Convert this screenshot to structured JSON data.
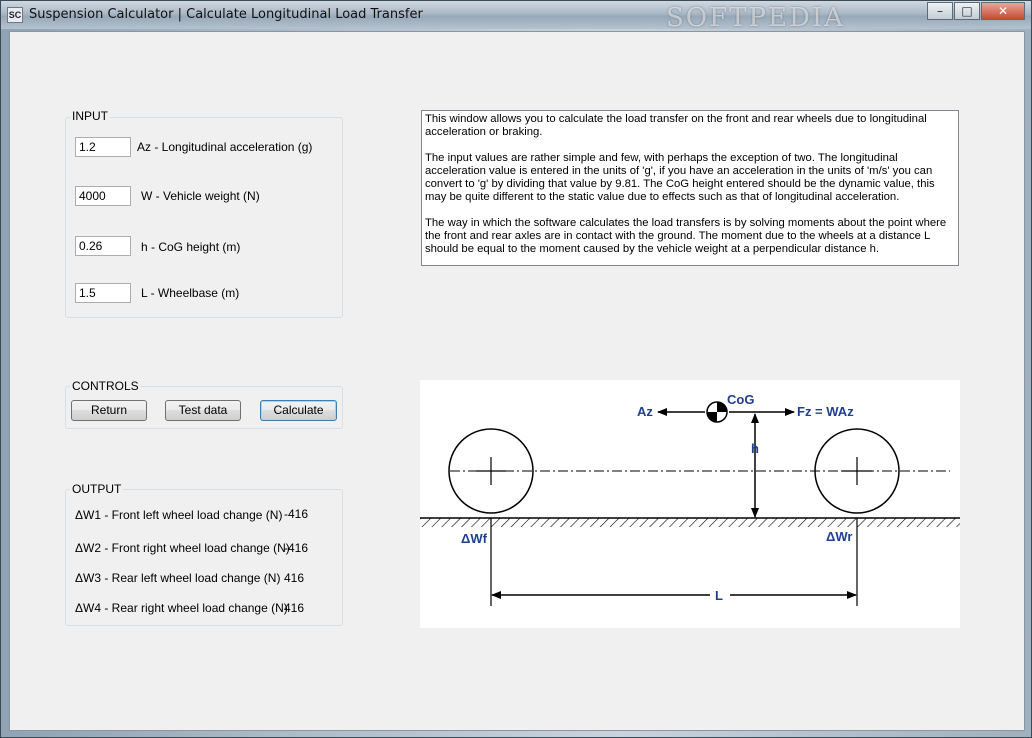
{
  "window": {
    "title": "Suspension Calculator | Calculate Longitudinal Load Transfer",
    "icon_text": "SC",
    "watermark": "SOFTPEDIA",
    "controls": {
      "minimize": "–",
      "maximize": "□",
      "close": "✕"
    }
  },
  "input": {
    "label": "INPUT",
    "fields": [
      {
        "value": "1.2",
        "label": "Az - Longitudinal acceleration (g)"
      },
      {
        "value": "4000",
        "label": "W - Vehicle weight (N)"
      },
      {
        "value": "0.26",
        "label": "h - CoG height (m)"
      },
      {
        "value": "1.5",
        "label": "L - Wheelbase (m)"
      }
    ]
  },
  "controls": {
    "label": "CONTROLS",
    "return_label": "Return",
    "testdata_label": "Test data",
    "calculate_label": "Calculate"
  },
  "output": {
    "label": "OUTPUT",
    "rows": [
      {
        "label": "ΔW1 - Front left wheel load change (N)",
        "value": "-416"
      },
      {
        "label": "ΔW2 - Front right wheel load change (N)",
        "value": "-416"
      },
      {
        "label": "ΔW3 - Rear left wheel load change (N)",
        "value": "416"
      },
      {
        "label": "ΔW4 - Rear right wheel load change (N)",
        "value": "416"
      }
    ]
  },
  "description": {
    "paragraphs": [
      "This window allows you to calculate the load transfer on the front and rear wheels due to longitudinal acceleration or braking.",
      "The input values are rather simple and few, with perhaps the exception of two. The longitudinal acceleration value is entered in the units of 'g', if you have an acceleration in the units of 'm/s' you can convert to 'g' by dividing that value by 9.81. The CoG height entered should be the dynamic value, this may be quite different to the static value due to effects such as that of longitudinal acceleration.",
      "The way in which the software calculates the load transfers is by solving moments about the point where the front and rear axles are in contact with the ground. The moment due to the wheels at a distance L should be equal to the moment caused by the vehicle weight at a perpendicular distance h."
    ]
  },
  "diagram": {
    "cog": "CoG",
    "az": "Az",
    "fz": "Fz = WAz",
    "h": "h",
    "dwf": "ΔWf",
    "dwr": "ΔWr",
    "l": "L",
    "label_color": "#1f3f8f"
  }
}
